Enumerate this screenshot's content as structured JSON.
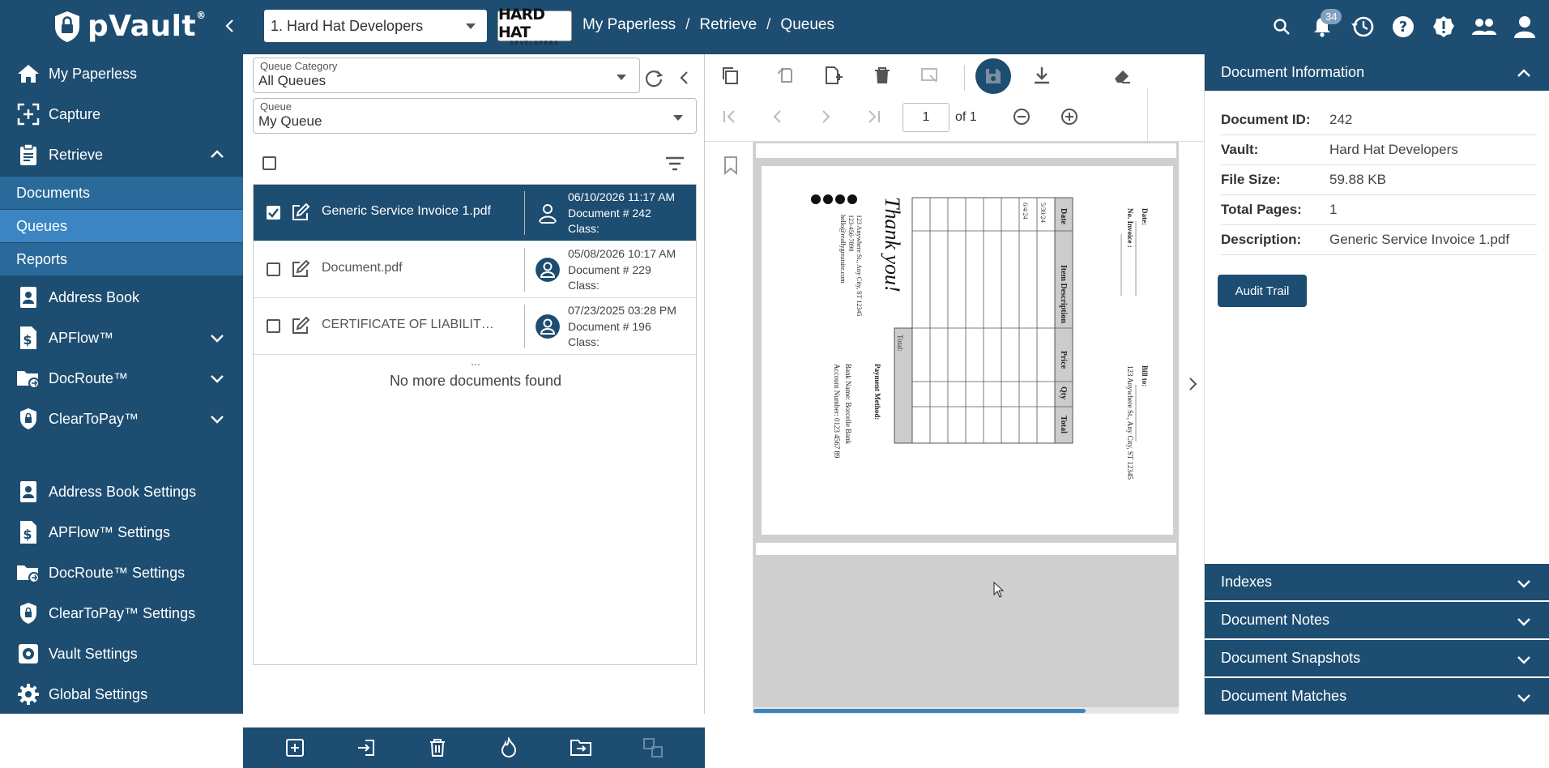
{
  "app": {
    "name": "pVault",
    "trademark": "®"
  },
  "vault_select": {
    "value": "1. Hard Hat Developers"
  },
  "brand_logo": {
    "line1": "HARD HAT",
    "line2": "DEVELOPERS"
  },
  "breadcrumb": [
    "My Paperless",
    "/",
    "Retrieve",
    "/",
    "Queues"
  ],
  "notifications": {
    "count": "34"
  },
  "sidebar": {
    "items": [
      {
        "label": "My Paperless",
        "icon": "home-icon"
      },
      {
        "label": "Capture",
        "icon": "capture-icon"
      },
      {
        "label": "Retrieve",
        "icon": "clipboard-icon"
      },
      {
        "label": "Address Book",
        "icon": "address-book-icon"
      },
      {
        "label": "APFlow™",
        "icon": "dollar-doc-icon"
      },
      {
        "label": "DocRoute™",
        "icon": "folder-route-icon"
      },
      {
        "label": "ClearToPay™",
        "icon": "lock-shield-icon"
      },
      {
        "label": "Address Book Settings",
        "icon": "address-book-icon"
      },
      {
        "label": "APFlow™ Settings",
        "icon": "dollar-doc-icon"
      },
      {
        "label": "DocRoute™ Settings",
        "icon": "folder-route-icon"
      },
      {
        "label": "ClearToPay™ Settings",
        "icon": "lock-shield-icon"
      },
      {
        "label": "Vault Settings",
        "icon": "gear-icon"
      },
      {
        "label": "Global Settings",
        "icon": "gear-icon"
      }
    ],
    "subitems": [
      "Documents",
      "Queues",
      "Reports"
    ]
  },
  "queue_panel": {
    "category_label": "Queue Category",
    "category_value": "All Queues",
    "queue_label": "Queue",
    "queue_value": "My Queue",
    "rows": [
      {
        "name": "Generic Service Invoice 1.pdf",
        "date": "06/10/2026 11:17 AM",
        "docnum": "Document # 242",
        "class": "Class:",
        "selected": true
      },
      {
        "name": "Document.pdf",
        "date": "05/08/2026 10:17 AM",
        "docnum": "Document # 229",
        "class": "Class:",
        "selected": false
      },
      {
        "name": "CERTIFICATE OF LIABILITY INS...",
        "date": "07/23/2025 03:28 PM",
        "docnum": "Document # 196",
        "class": "Class:",
        "selected": false
      }
    ],
    "ellipsis": "...",
    "no_more": "No more documents found"
  },
  "viewer": {
    "page": "1",
    "of_pages": "of 1",
    "invoice": {
      "thank_you": "Thank you!",
      "address": "123 Anywhere St., Any City, ST 12345",
      "phone": "123-456-7890",
      "email": "hello@reallygreatsite.com",
      "payment_method": "Payment Method:",
      "bank": "Bank Name: Borcelle Bank",
      "account": "Account Number: 0123 4567 89",
      "date_label": "Date:",
      "invoice_label": "No. Invoice :",
      "bill_to": "Bill to:",
      "bill_addr": "123 Anywhere St., Any City, ST 12345",
      "col_date": "Date",
      "col_item": "Item Description",
      "col_price": "Price",
      "col_qty": "Qty",
      "col_total": "Total",
      "total_label": "Total:",
      "row1_date": "5/30/24",
      "row2_date": "6/4/24"
    }
  },
  "doc_info": {
    "title": "Document Information",
    "rows": [
      {
        "k": "Document ID:",
        "v": "242"
      },
      {
        "k": "Vault:",
        "v": "Hard Hat Developers"
      },
      {
        "k": "File Size:",
        "v": "59.88 KB"
      },
      {
        "k": "Total Pages:",
        "v": "1"
      },
      {
        "k": "Description:",
        "v": "Generic Service Invoice 1.pdf"
      }
    ],
    "audit_button": "Audit Trail"
  },
  "accordions": [
    "Indexes",
    "Document Notes",
    "Document Snapshots",
    "Document Matches"
  ],
  "colors": {
    "primary": "#1d4d71",
    "sub": "#2a6a9b",
    "active": "#3b86c2"
  }
}
